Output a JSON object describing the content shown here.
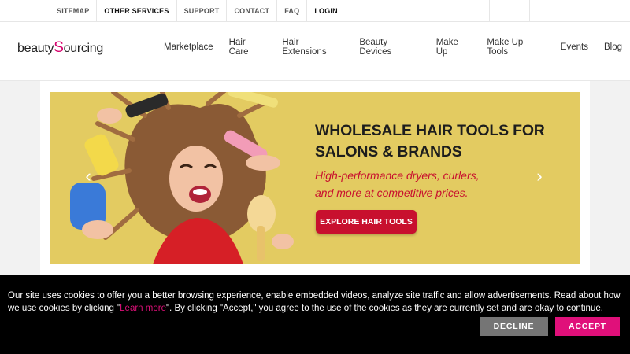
{
  "utility_nav": [
    "SITEMAP",
    "OTHER SERVICES",
    "SUPPORT",
    "CONTACT",
    "FAQ",
    "LOGIN"
  ],
  "logo": {
    "part1": "beauty",
    "accent_letter": "S",
    "part2": "ourcing",
    "accent_color": "#d6006b"
  },
  "main_nav": [
    "Marketplace",
    "Hair Care",
    "Hair Extensions",
    "Beauty Devices",
    "Make Up",
    "Make Up Tools",
    "Events",
    "Blog"
  ],
  "hero": {
    "headline_line1": "WHOLESALE HAIR TOOLS FOR",
    "headline_line2": "SALONS & BRANDS",
    "sub_line1": "High-performance dryers, curlers,",
    "sub_line2": "and more at competitive prices.",
    "cta": "EXPLORE HAIR TOOLS",
    "prev_arrow": "‹",
    "next_arrow": "›",
    "background_color": "#e3cb61",
    "accent_color": "#c8102e"
  },
  "cookie": {
    "text_before": "Our site uses cookies to offer you a better browsing experience, enable embedded videos, analyze site traffic and allow advertisements. Read about how we use cookies by clicking \"",
    "link": "Learn more",
    "text_after": "\". By clicking \"Accept,\" you agree to the use of the cookies as they are currently set and are okay to continue.",
    "decline": "DECLINE",
    "accept": "ACCEPT",
    "accept_color": "#e0107a"
  }
}
